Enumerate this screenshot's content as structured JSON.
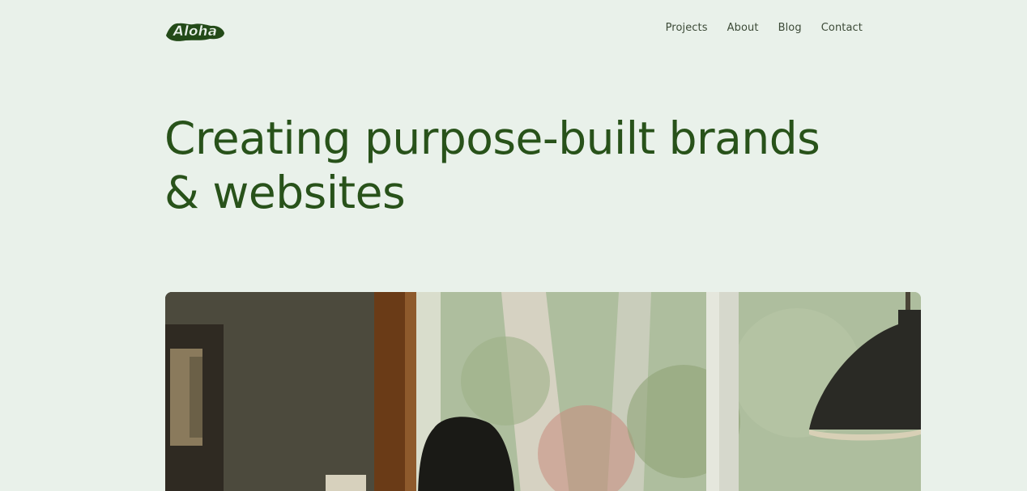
{
  "header": {
    "logo_text": "Aloha",
    "nav": [
      {
        "label": "Projects"
      },
      {
        "label": "About"
      },
      {
        "label": "Blog"
      },
      {
        "label": "Contact"
      }
    ]
  },
  "hero": {
    "title_line1": "Creating purpose-built brands",
    "title_line2": "& websites"
  },
  "colors": {
    "background": "#e9f1ea",
    "accent_green": "#28521a"
  }
}
